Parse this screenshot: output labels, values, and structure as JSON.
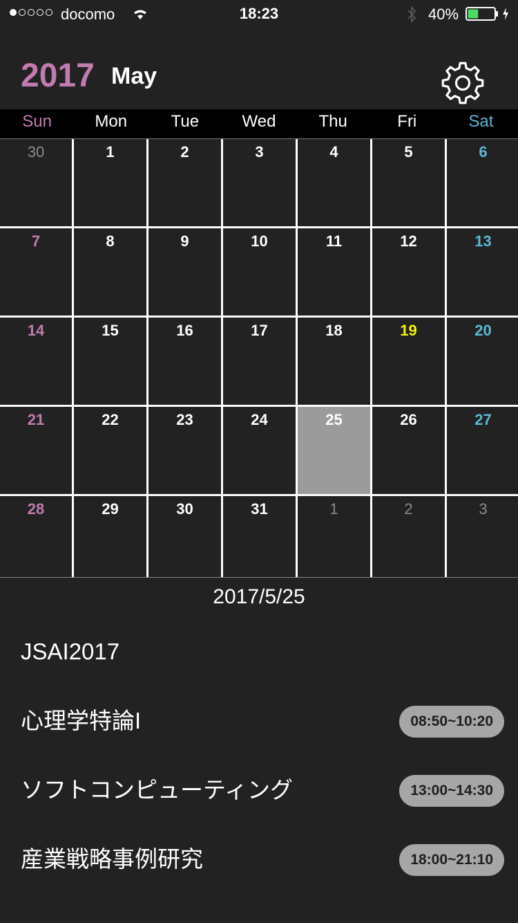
{
  "status_bar": {
    "carrier": "docomo",
    "time": "18:23",
    "battery_percent": "40%",
    "battery_level": 0.4,
    "battery_color": "#4cd964"
  },
  "header": {
    "year": "2017",
    "month": "May",
    "settings_icon": "gear-icon"
  },
  "weekdays": [
    "Sun",
    "Mon",
    "Tue",
    "Wed",
    "Thu",
    "Fri",
    "Sat"
  ],
  "calendar": {
    "weeks": [
      [
        "30",
        "1",
        "2",
        "3",
        "4",
        "5",
        "6"
      ],
      [
        "7",
        "8",
        "9",
        "10",
        "11",
        "12",
        "13"
      ],
      [
        "14",
        "15",
        "16",
        "17",
        "18",
        "19",
        "20"
      ],
      [
        "21",
        "22",
        "23",
        "24",
        "25",
        "26",
        "27"
      ],
      [
        "28",
        "29",
        "30",
        "31",
        "1",
        "2",
        "3"
      ]
    ],
    "today": "19",
    "selected": "25",
    "colors": {
      "sunday": "#c27bae",
      "saturday": "#5cb8d6",
      "today": "#f5f500",
      "other_month": "#8c8c8c",
      "selected_bg": "#9b9b9b"
    }
  },
  "detail": {
    "date": "2017/5/25",
    "events": [
      {
        "title": "JSAI2017",
        "time": ""
      },
      {
        "title": "心理学特論I",
        "time": "08:50~10:20"
      },
      {
        "title": "ソフトコンピューティング",
        "time": "13:00~14:30"
      },
      {
        "title": "産業戦略事例研究",
        "time": "18:00~21:10"
      }
    ]
  }
}
